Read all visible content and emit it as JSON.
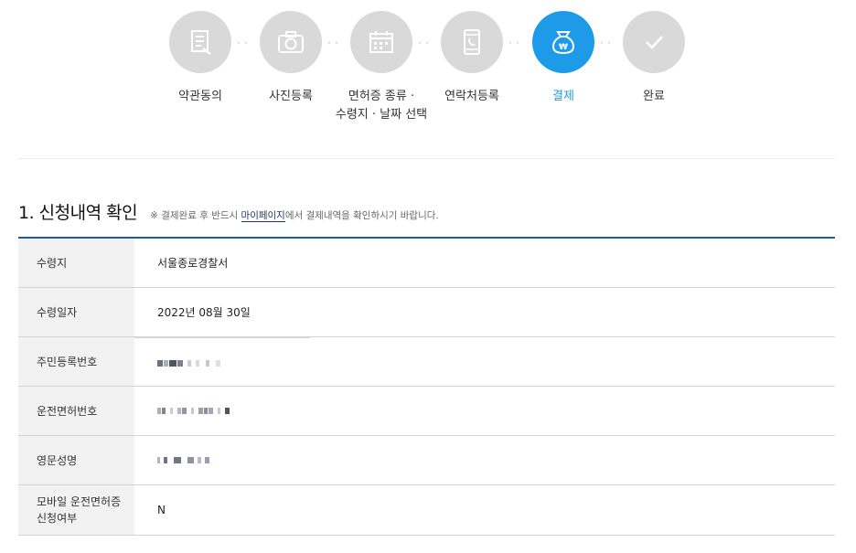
{
  "stepper": {
    "steps": [
      {
        "label_line1": "약관동의",
        "label_line2": "",
        "icon": "document-icon",
        "active": false
      },
      {
        "label_line1": "사진등록",
        "label_line2": "",
        "icon": "camera-icon",
        "active": false
      },
      {
        "label_line1": "면허증 종류 ·",
        "label_line2": "수령지 · 날짜 선택",
        "icon": "calendar-icon",
        "active": false
      },
      {
        "label_line1": "연락처등록",
        "label_line2": "",
        "icon": "phone-icon",
        "active": false
      },
      {
        "label_line1": "결제",
        "label_line2": "",
        "icon": "won-bag-icon",
        "active": true
      },
      {
        "label_line1": "완료",
        "label_line2": "",
        "icon": "check-icon",
        "active": false
      }
    ],
    "separator": "··"
  },
  "section": {
    "title": "1. 신청내역 확인",
    "note_prefix": "※ 결제완료 후 반드시 ",
    "note_link": "마이페이지",
    "note_suffix": "에서 결제내역을 확인하시기 바랍니다."
  },
  "table": {
    "rows": [
      {
        "label": "수령지",
        "value": "서울종로경찰서"
      },
      {
        "label": "수령일자",
        "value": "2022년 08월 30일"
      },
      {
        "label": "주민등록번호",
        "value": ""
      },
      {
        "label": "운전면허번호",
        "value": ""
      },
      {
        "label": "영문성명",
        "value": ""
      },
      {
        "label_line1": "모바일 운전면허증",
        "label_line2": "신청여부",
        "value": "N"
      }
    ]
  },
  "colors": {
    "accent": "#1d9be8",
    "inactive_step": "#d9d9d9",
    "table_border": "#1d5cab",
    "label_bg": "#f2f2f2"
  }
}
